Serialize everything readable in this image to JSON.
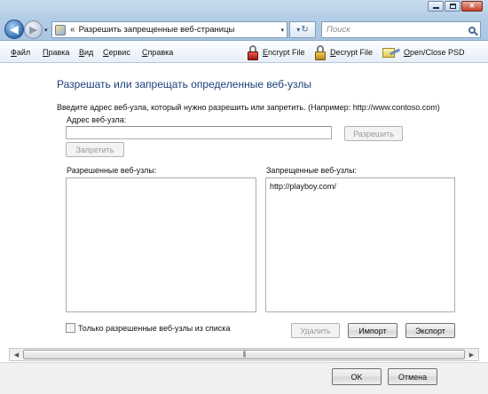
{
  "window": {
    "minimize_glyph": "—",
    "maximize_glyph": "□",
    "close_glyph": "✕"
  },
  "nav": {
    "back_glyph": "◀",
    "forward_glyph": "▶",
    "history_glyph": "▾"
  },
  "address": {
    "chevron": "«",
    "text": "Разрешить запрещенные веб-страницы",
    "dropdown_glyph": "▾"
  },
  "refresh": {
    "arrow_glyph": "▾",
    "refresh_glyph": "↻"
  },
  "search": {
    "placeholder": "Поиск"
  },
  "menu": {
    "items": [
      "Файл",
      "Правка",
      "Вид",
      "Сервис",
      "Справка"
    ]
  },
  "tools": {
    "encrypt": {
      "key": "E",
      "rest": "ncrypt File"
    },
    "decrypt": {
      "key": "D",
      "rest": "ecrypt File"
    },
    "psd": {
      "key": "O",
      "rest": "pen/Close PSD"
    }
  },
  "content": {
    "heading": "Разрешать или запрещать определенные веб-узлы",
    "instruction": "Введите адрес веб-узла, который нужно разрешить или запретить. (Например: http://www.contoso.com)",
    "address_label": "Адрес веб-узла:",
    "address_value": "",
    "block_button": "Запретить",
    "allow_button": "Разрешить",
    "allowed_label": "Разрешенные веб-узлы:",
    "allowed_sites": [],
    "blocked_label": "Запрещенные веб-узлы:",
    "blocked_sites": [
      "http://playboy.com/"
    ],
    "only_allowed_label": "Только разрешенные веб-узлы из списка",
    "only_allowed_checked": false,
    "remove_button": "Удалить",
    "import_button": "Импорт",
    "export_button": "Экспорт"
  },
  "scrollbar": {
    "left_glyph": "◀",
    "right_glyph": "▶",
    "grip": "|||"
  },
  "footer": {
    "ok_button": "OK",
    "cancel_button": "Отмена"
  },
  "colors": {
    "heading": "#1c3f7a",
    "title_bar": "#b3cde6",
    "close_button": "#c4402a"
  }
}
